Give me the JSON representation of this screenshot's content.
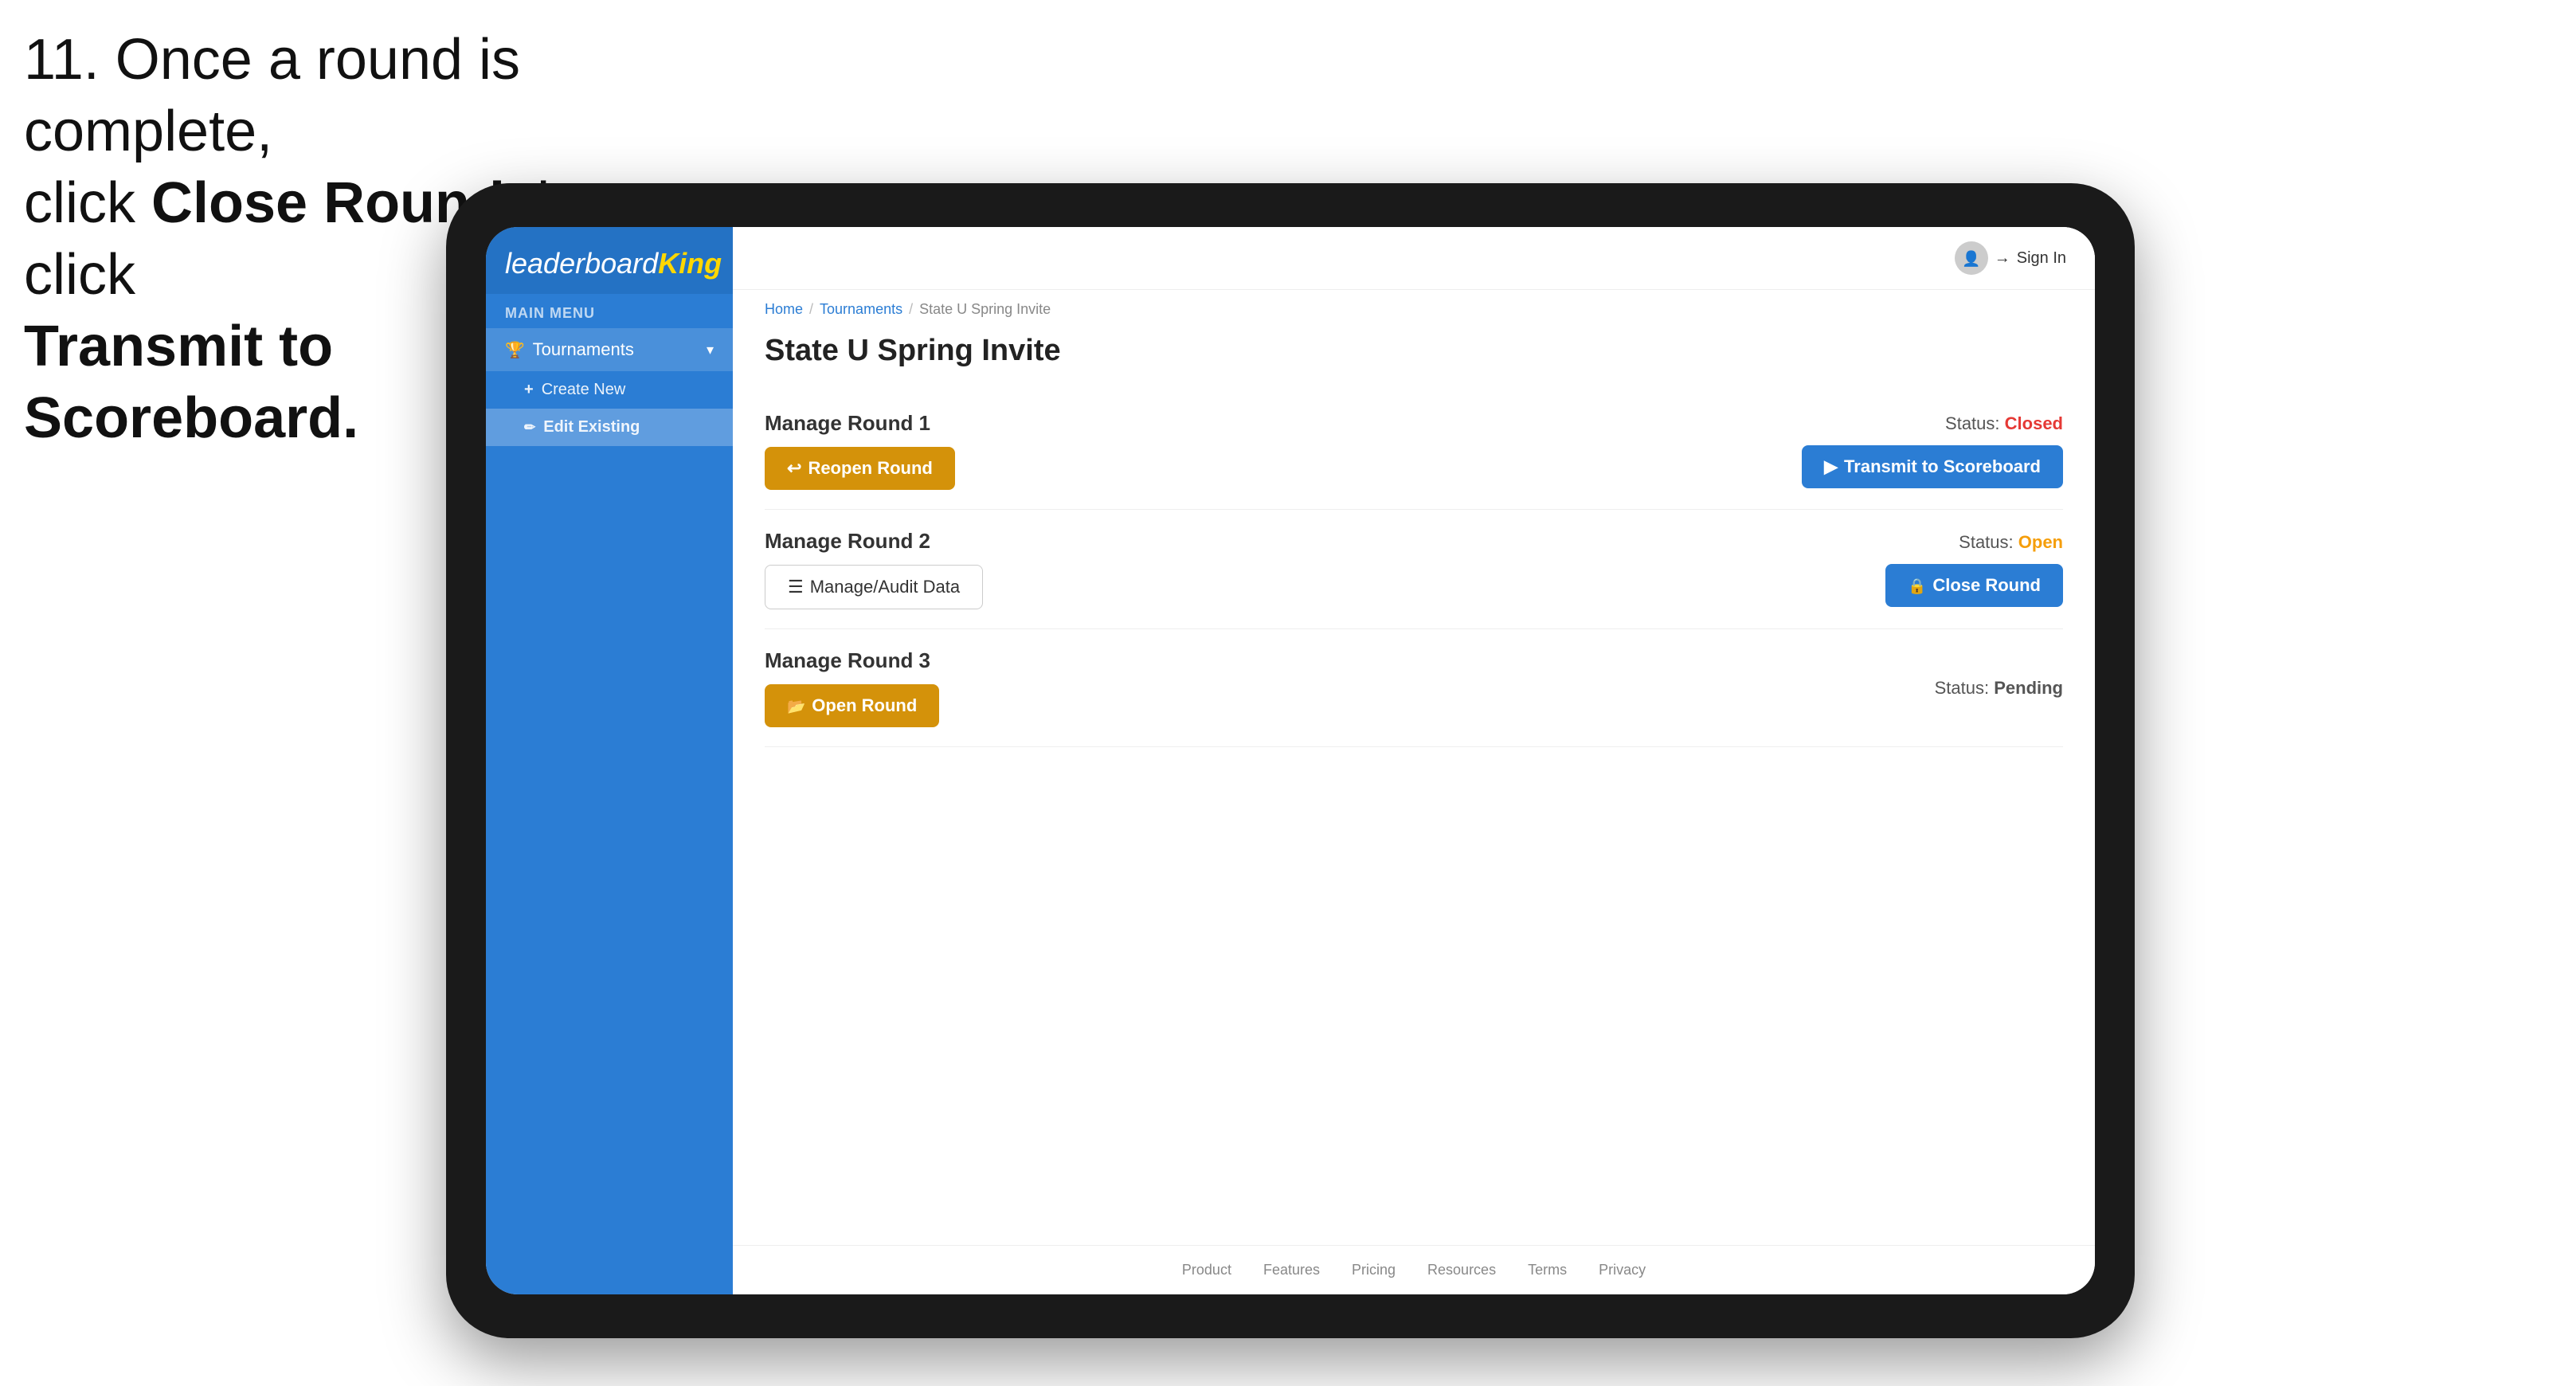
{
  "instruction": {
    "line1": "11. Once a round is complete,",
    "line2": "click ",
    "bold1": "Close Round",
    "line3": " then click",
    "bold2": "Transmit to Scoreboard."
  },
  "header": {
    "signin_label": "Sign In"
  },
  "breadcrumb": {
    "home": "Home",
    "separator1": "/",
    "tournaments": "Tournaments",
    "separator2": "/",
    "current": "State U Spring Invite"
  },
  "page": {
    "title": "State U Spring Invite"
  },
  "sidebar": {
    "menu_label": "MAIN MENU",
    "logo_leaderboard": "leaderboard",
    "logo_king": "King",
    "tournaments_label": "Tournaments",
    "create_new_label": "Create New",
    "edit_existing_label": "Edit Existing"
  },
  "rounds": [
    {
      "title": "Manage Round 1",
      "status_label": "Status:",
      "status_value": "Closed",
      "status_class": "status-closed",
      "left_button_label": "Reopen Round",
      "left_button_type": "gold",
      "right_button_label": "Transmit to Scoreboard",
      "right_button_type": "blue",
      "show_manage": false
    },
    {
      "title": "Manage Round 2",
      "status_label": "Status:",
      "status_value": "Open",
      "status_class": "status-open",
      "left_button_label": "Manage/Audit Data",
      "left_button_type": "manage",
      "right_button_label": "Close Round",
      "right_button_type": "blue",
      "show_manage": true
    },
    {
      "title": "Manage Round 3",
      "status_label": "Status:",
      "status_value": "Pending",
      "status_class": "status-pending",
      "left_button_label": "Open Round",
      "left_button_type": "gold",
      "right_button_label": null,
      "right_button_type": null,
      "show_manage": false
    }
  ],
  "footer": {
    "links": [
      "Product",
      "Features",
      "Pricing",
      "Resources",
      "Terms",
      "Privacy"
    ]
  },
  "colors": {
    "blue": "#2b7dd4",
    "gold": "#d4920a",
    "closed_red": "#e53935",
    "open_orange": "#f59e0b",
    "sidebar_bg": "#2b7dd4"
  }
}
